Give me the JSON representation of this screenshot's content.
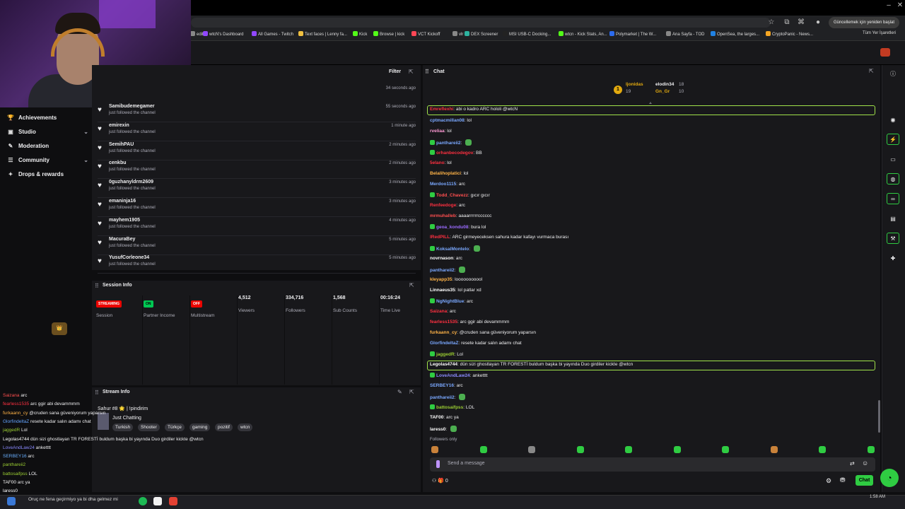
{
  "browser": {
    "update_btn": "Güncellemek için yeniden başlat",
    "bookmarks": [
      "edit",
      "wtcN's Dashboard",
      "All Games - Twitch",
      "Text faces | Lenny fa...",
      "Kick",
      "Browse | kick",
      "VCT Kickoff",
      "vlr",
      "DEX Screener",
      "MSI USB-C Docking...",
      "wtcn - Kick Stats, An...",
      "Polymarket | The W...",
      "Ana Sayfa - TOD",
      "OpenSea, the larges...",
      "CryptoPanic - News..."
    ],
    "bookmarks_all": "Tüm Yer İşaretleri"
  },
  "sidebar": {
    "items": [
      {
        "label": "Achievements",
        "icon": "trophy-icon",
        "chevron": false
      },
      {
        "label": "Studio",
        "icon": "studio-icon",
        "chevron": true
      },
      {
        "label": "Moderation",
        "icon": "wrench-icon",
        "chevron": false
      },
      {
        "label": "Community",
        "icon": "community-icon",
        "chevron": true
      },
      {
        "label": "Drops & rewards",
        "icon": "gift-icon",
        "chevron": false
      }
    ]
  },
  "activity": {
    "filter_label": "Filter",
    "first_time": "34 seconds ago",
    "feed": [
      {
        "user": "Samibudemegamer",
        "sub": "just followed the channel",
        "time": "55 seconds ago"
      },
      {
        "user": "emirexin",
        "sub": "just followed the channel",
        "time": "1 minute ago"
      },
      {
        "user": "SemihPAU",
        "sub": "just followed the channel",
        "time": "2 minutes ago"
      },
      {
        "user": "cenkbu",
        "sub": "just followed the channel",
        "time": "2 minutes ago"
      },
      {
        "user": "0guzhanyldrm2609",
        "sub": "just followed the channel",
        "time": "3 minutes ago"
      },
      {
        "user": "emaninja16",
        "sub": "just followed the channel",
        "time": "3 minutes ago"
      },
      {
        "user": "mayhem1905",
        "sub": "just followed the channel",
        "time": "4 minutes ago"
      },
      {
        "user": "MacuraBey",
        "sub": "just followed the channel",
        "time": "5 minutes ago"
      },
      {
        "user": "YusufCorleone34",
        "sub": "just followed the channel",
        "time": "5 minutes ago"
      }
    ]
  },
  "session": {
    "title": "Session Info",
    "cols": [
      {
        "pill": "STREAMING",
        "label": "Session"
      },
      {
        "pill": "ON",
        "label": "Partner Income"
      },
      {
        "pill": "OFF",
        "label": "Multistream"
      },
      {
        "num": "4,512",
        "label": "Viewers"
      },
      {
        "num": "334,716",
        "label": "Followers"
      },
      {
        "num": "1,568",
        "label": "Sub Counts"
      },
      {
        "num": "00:16:24",
        "label": "Time Live"
      }
    ]
  },
  "stream_info": {
    "title": "Stream Info",
    "line": "Sahur #8 🌟 | !pindirim",
    "category": "Just Chatting",
    "tags": [
      "Turkish",
      "Shooter",
      "Türkçe",
      "gaming",
      "pozitif",
      "wtcn"
    ]
  },
  "overlay_chat": [
    {
      "user": "Saizana",
      "color": "#ff4f4f",
      "text": "arc"
    },
    {
      "user": "fearless1535",
      "color": "#ff3040",
      "text": "arc ggir abi devammmm"
    },
    {
      "user": "furkaann_cy",
      "color": "#ffb347",
      "text": "@cruden sana güveniyorum yaparsın"
    },
    {
      "user": "GlorfindeltaZ",
      "color": "#63a4ff",
      "text": "resete kadar salın adamı chat"
    },
    {
      "user": "jaggedR",
      "color": "#9acd32",
      "text": "Lol"
    },
    {
      "user": "Legolas4744",
      "color": "#ffffff",
      "text": "dün sizi ghostlayan TR FORESTİ buldum başka bi yayında Duo girdiler kickte @wtcn"
    },
    {
      "user": "LoveAndLaw24",
      "color": "#8a8aff",
      "text": "anketttt"
    },
    {
      "user": "SERBEY16",
      "color": "#6ab0ff",
      "text": "arc"
    },
    {
      "user": "panthareii2",
      "color": "#9acd32",
      "text": ""
    },
    {
      "user": "battosaifpss",
      "color": "#9acd32",
      "text": "LOL"
    },
    {
      "user": "TAF00",
      "color": "#ffffff",
      "text": "arc ya"
    },
    {
      "user": "laress0",
      "color": "#ffffff",
      "text": ""
    }
  ],
  "ticker": "Oruç ne fena geçirmiyo ya bi dha gelmez mi",
  "clock": "1:58 AM",
  "chat": {
    "title": "Chat",
    "leaderboard": [
      {
        "rank": "1",
        "user": "ljonidas",
        "points": "19"
      },
      {
        "user": "elodin34",
        "points": "18"
      },
      {
        "user": "Gn_Gr",
        "points": "10"
      }
    ],
    "messages": [
      {
        "user": "Emreflexhi",
        "color": "#ff3040",
        "text": "abi o kadro ARC hololi @wtcN"
      },
      {
        "user": "cptmacmillan08",
        "color": "#7aa8ff",
        "text": "lol"
      },
      {
        "user": "rveliaa",
        "color": "#ff9ad5",
        "text": "lol"
      },
      {
        "user": "panthareii2",
        "color": "#7aa8ff",
        "text": ""
      },
      {
        "user": "orhanbecodegov",
        "color": "#ff3040",
        "text": "BB"
      },
      {
        "user": "5elano",
        "color": "#ff3040",
        "text": "lol"
      },
      {
        "user": "Belalihoplatici",
        "color": "#ffb347",
        "text": "lol"
      },
      {
        "user": "Merdoo1115",
        "color": "#7aa8ff",
        "text": "arc"
      },
      {
        "user": "Todd_Chavezz",
        "color": "#ff4f4f",
        "text": "gıcır gıcır"
      },
      {
        "user": "Renfeedoge",
        "color": "#ff3040",
        "text": "arc"
      },
      {
        "user": "mrmuhalleb",
        "color": "#ff4f4f",
        "text": "aaaarrrrrrcccccc"
      },
      {
        "user": "geoa_kondu08",
        "color": "#9b6bff",
        "text": "bura lol"
      },
      {
        "user": "lRedPILL",
        "color": "#ff3040",
        "text": "ARC girmeyeceksen sahura kadar kafayı vurmaca burası"
      },
      {
        "user": "KoksalMontelo",
        "color": "#7aa8ff",
        "text": ""
      },
      {
        "user": "novrnason",
        "color": "#ffffff",
        "text": "arc"
      },
      {
        "user": "panthareii2",
        "color": "#7aa8ff",
        "text": ""
      },
      {
        "user": "kleyapp35",
        "color": "#ffb347",
        "text": "looooooooool"
      },
      {
        "user": "Linnaeus35",
        "color": "#ffffff",
        "text": "lol patlar xd"
      },
      {
        "user": "NgNightBlue",
        "color": "#7aa8ff",
        "text": "arc"
      },
      {
        "user": "Saizana",
        "color": "#ff3040",
        "text": "arc"
      },
      {
        "user": "fearless1535",
        "color": "#ff3040",
        "text": "arc ggir abi devammmm"
      },
      {
        "user": "furkaann_cy",
        "color": "#ffb347",
        "text": "@cruden sana güveniyorum yaparsın"
      },
      {
        "user": "GlorfindeltaZ",
        "color": "#7aa8ff",
        "text": "resete kadar salın adamı chat"
      },
      {
        "user": "jaggedR",
        "color": "#9acd32",
        "text": "Lol"
      },
      {
        "user": "Legolas4744",
        "color": "#ffffff",
        "text": "dün sizi ghostlayan TR FORESTİ buldum başka bi yayında Duo girdiler kickte @wtcn"
      },
      {
        "user": "LoveAndLaw24",
        "color": "#8a8aff",
        "text": "anketttt"
      },
      {
        "user": "SERBEY16",
        "color": "#7aa8ff",
        "text": "arc"
      },
      {
        "user": "panthareii2",
        "color": "#7aa8ff",
        "text": ""
      },
      {
        "user": "battosaifpss",
        "color": "#9acd32",
        "text": "LOL"
      },
      {
        "user": "TAF00",
        "color": "#ffffff",
        "text": "arc ya"
      },
      {
        "user": "laress0",
        "color": "#ffffff",
        "text": ""
      }
    ],
    "followers_only": "Followers only",
    "input_placeholder": "Send a message",
    "chat_button": "Chat",
    "footer_points": "0"
  }
}
